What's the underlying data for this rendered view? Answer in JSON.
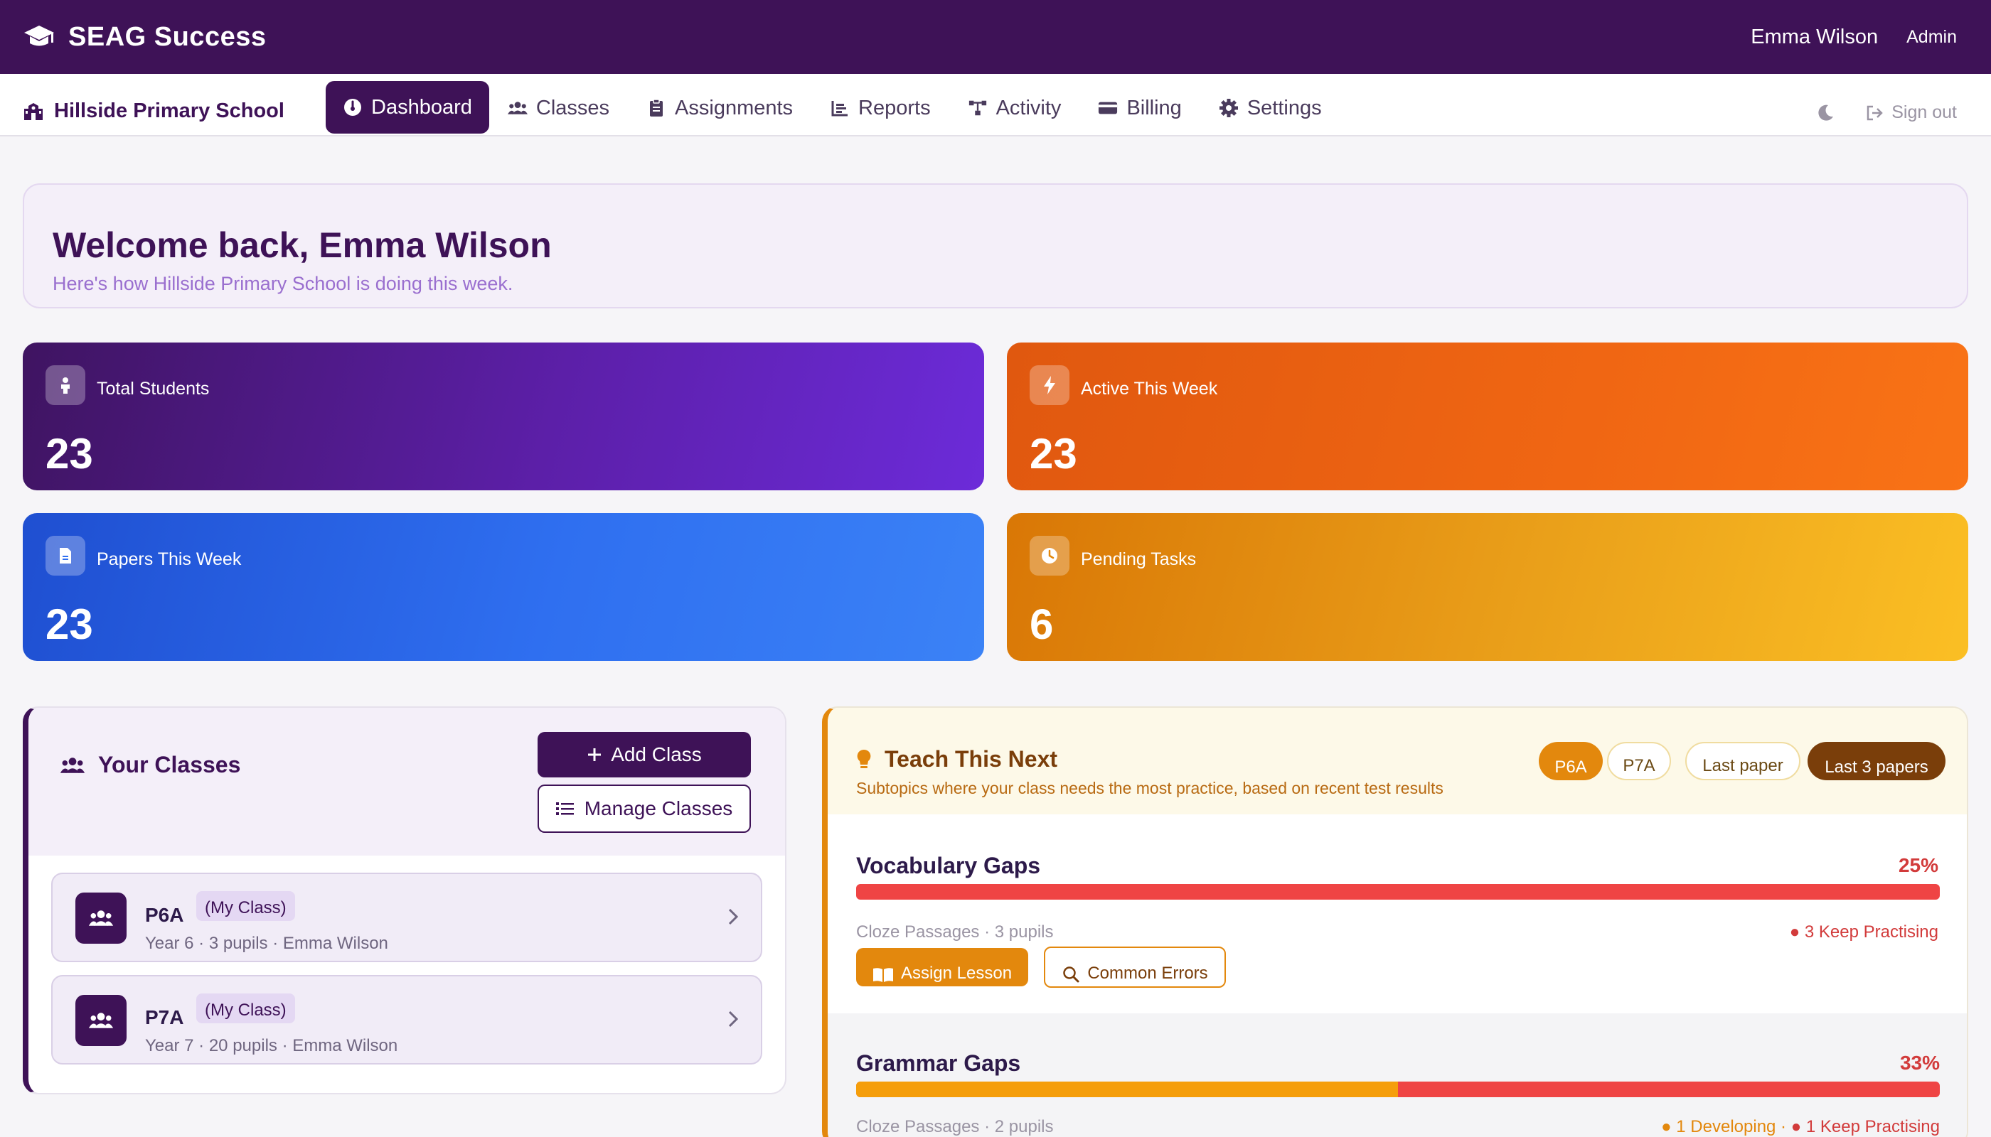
{
  "topbar": {
    "brand": "SEAG Success",
    "user_name": "Emma Wilson",
    "user_role": "Admin"
  },
  "navbar": {
    "school": "Hillside Primary School",
    "items": [
      {
        "label": "Dashboard",
        "icon": "gauge-icon",
        "active": true
      },
      {
        "label": "Classes",
        "icon": "users-icon"
      },
      {
        "label": "Assignments",
        "icon": "clipboard-icon"
      },
      {
        "label": "Reports",
        "icon": "chart-icon"
      },
      {
        "label": "Activity",
        "icon": "network-icon"
      },
      {
        "label": "Billing",
        "icon": "credit-card-icon"
      },
      {
        "label": "Settings",
        "icon": "gear-icon"
      }
    ],
    "sign_out": "Sign out"
  },
  "welcome": {
    "title": "Welcome back, Emma Wilson",
    "subtitle": "Here's how Hillside Primary School is doing this week."
  },
  "stats": [
    {
      "label": "Total Students",
      "value": "23",
      "icon": "person-icon"
    },
    {
      "label": "Active This Week",
      "value": "23",
      "icon": "bolt-icon"
    },
    {
      "label": "Papers This Week",
      "value": "23",
      "icon": "document-icon"
    },
    {
      "label": "Pending Tasks",
      "value": "6",
      "icon": "clock-icon"
    }
  ],
  "classes": {
    "title": "Your Classes",
    "add_label": "Add Class",
    "manage_label": "Manage Classes",
    "items": [
      {
        "name": "P6A",
        "tag": "(My Class)",
        "meta": "Year 6 · 3 pupils · Emma Wilson"
      },
      {
        "name": "P7A",
        "tag": "(My Class)",
        "meta": "Year 7 · 20 pupils · Emma Wilson"
      }
    ]
  },
  "teach": {
    "title": "Teach This Next",
    "subtitle": "Subtopics where your class needs the most practice, based on recent test results",
    "filters": {
      "class_options": [
        "P6A",
        "P7A"
      ],
      "selected_class": "P6A",
      "range_options": [
        "Last paper",
        "Last 3 papers"
      ],
      "selected_range": "Last 3 papers"
    },
    "gaps": [
      {
        "title": "Vocabulary Gaps",
        "percent_label": "25%",
        "developing_fraction": 0,
        "meta": "Cloze Passages · 3 pupils",
        "status": "● 3 Keep Practising",
        "lesson_label": "Assign Lesson",
        "errors_label": "Common Errors"
      },
      {
        "title": "Grammar Gaps",
        "percent_label": "33%",
        "developing_fraction": 0.5,
        "meta": "Cloze Passages · 2 pupils",
        "status_developing": "● 1 Developing",
        "status_sep": " · ",
        "status_keep": "● 1 Keep Practising"
      }
    ]
  },
  "colors": {
    "brand": "#3e1257",
    "amber": "#e3880d",
    "red": "#ef4444",
    "orange": "#f59e0b"
  }
}
